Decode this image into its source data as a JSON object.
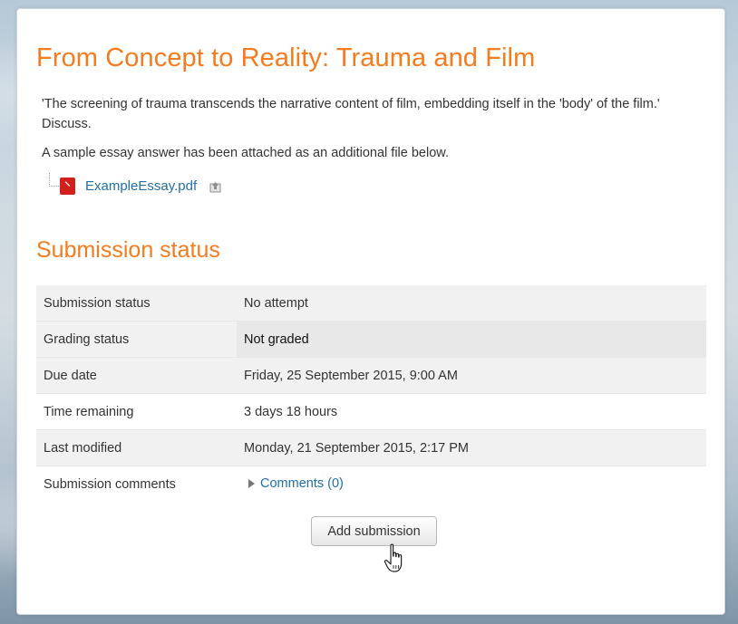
{
  "assignment": {
    "title": "From Concept to Reality: Trauma and Film",
    "description": "'The screening of trauma transcends the narrative content of film, embedding itself in the 'body' of the film.' Discuss.",
    "note": "A sample essay answer has been attached as an additional file below.",
    "file": {
      "name": "ExampleEssay.pdf",
      "icon": "pdf-icon",
      "action_icon": "portfolio-export-icon"
    }
  },
  "submission": {
    "heading": "Submission status",
    "rows": [
      {
        "label": "Submission status",
        "value": "No attempt"
      },
      {
        "label": "Grading status",
        "value": "Not graded"
      },
      {
        "label": "Due date",
        "value": "Friday, 25 September 2015, 9:00 AM"
      },
      {
        "label": "Time remaining",
        "value": "3 days 18 hours"
      },
      {
        "label": "Last modified",
        "value": "Monday, 21 September 2015, 2:17 PM"
      },
      {
        "label": "Submission comments",
        "value": "Comments (0)"
      }
    ],
    "button_label": "Add submission"
  },
  "colors": {
    "heading": "#f47b1e",
    "link": "#1f6fa8",
    "pdf_icon": "#d3201c"
  }
}
